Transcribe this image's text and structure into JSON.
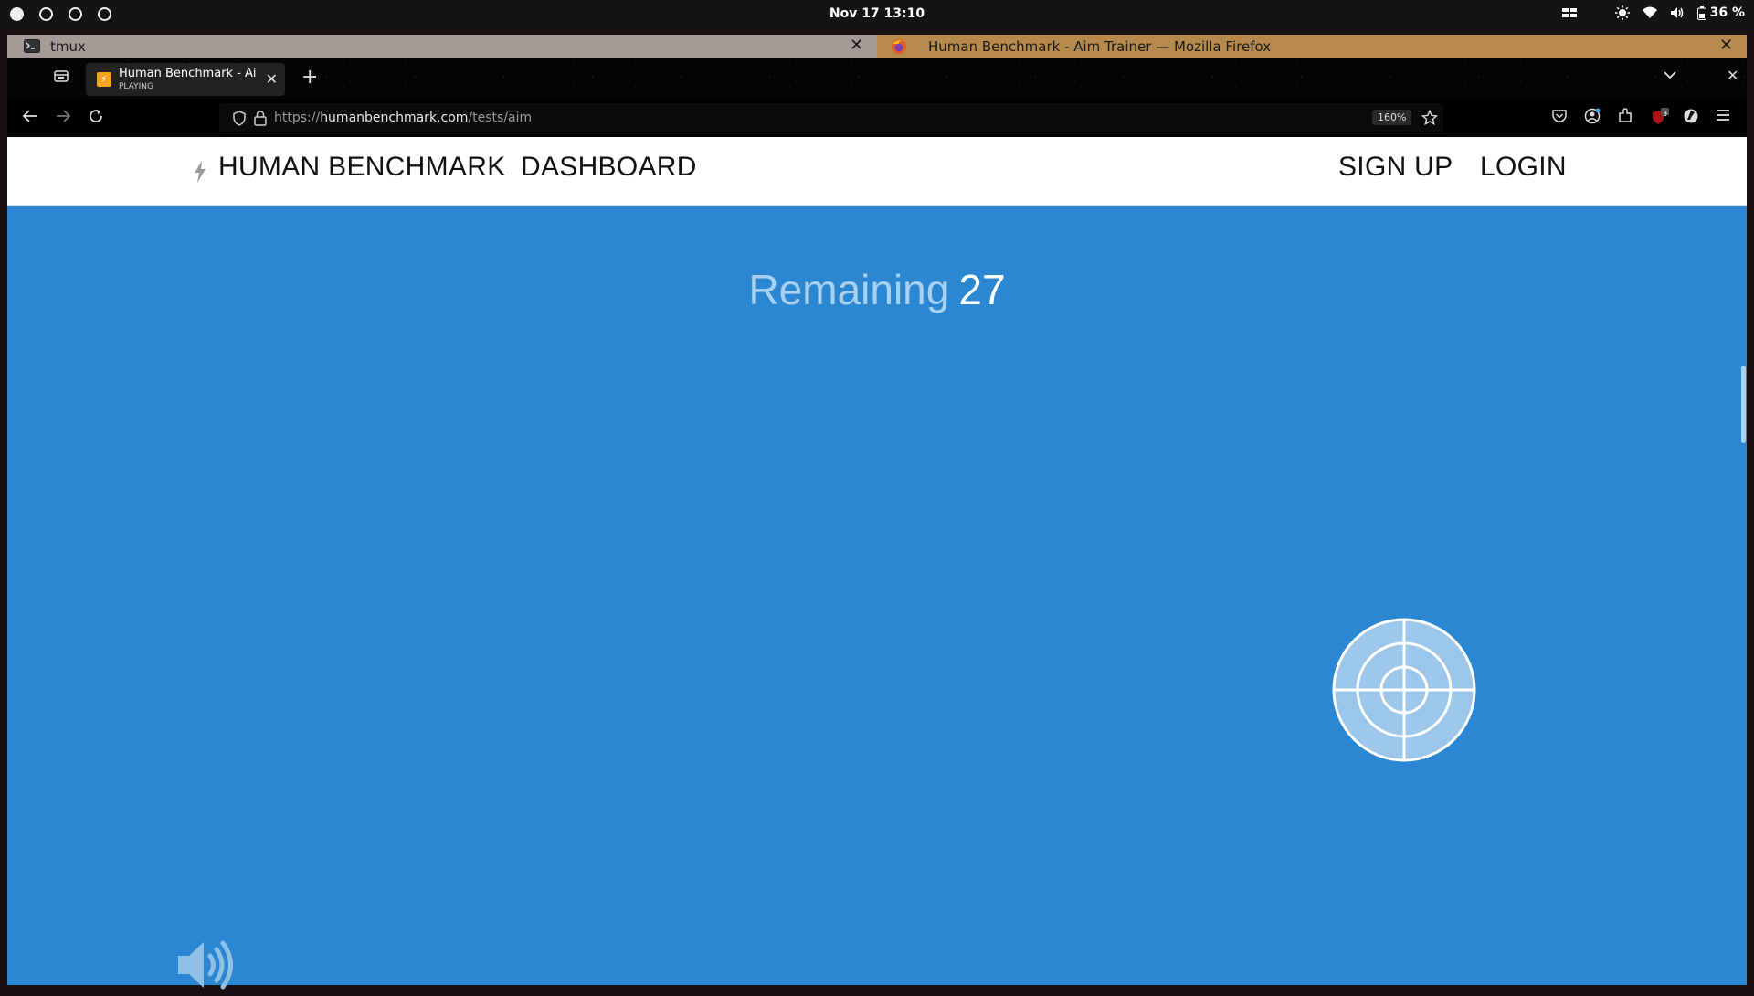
{
  "system": {
    "clock": "Nov 17  13:10",
    "battery": "36 %",
    "icons": [
      "workspaces-icon",
      "brightness-icon",
      "wifi-icon",
      "volume-icon",
      "battery-icon"
    ]
  },
  "tiles": {
    "tmux": {
      "label": "tmux"
    },
    "firefox": {
      "label": "Human Benchmark - Aim Trainer — Mozilla Firefox"
    }
  },
  "browser": {
    "tab": {
      "title": "Human Benchmark - Aim Trainer",
      "status": "PLAYING"
    },
    "url_prefix": "https://",
    "url_domain": "humanbenchmark.com",
    "url_path": "/tests/aim",
    "zoom": "160%",
    "extension_badge": "3"
  },
  "site": {
    "brand": "HUMAN BENCHMARK",
    "nav": {
      "dashboard": "DASHBOARD",
      "signup": "SIGN UP",
      "login": "LOGIN"
    }
  },
  "game": {
    "remaining_label": "Remaining",
    "remaining_value": "27",
    "background_color": "#2b87d1"
  }
}
